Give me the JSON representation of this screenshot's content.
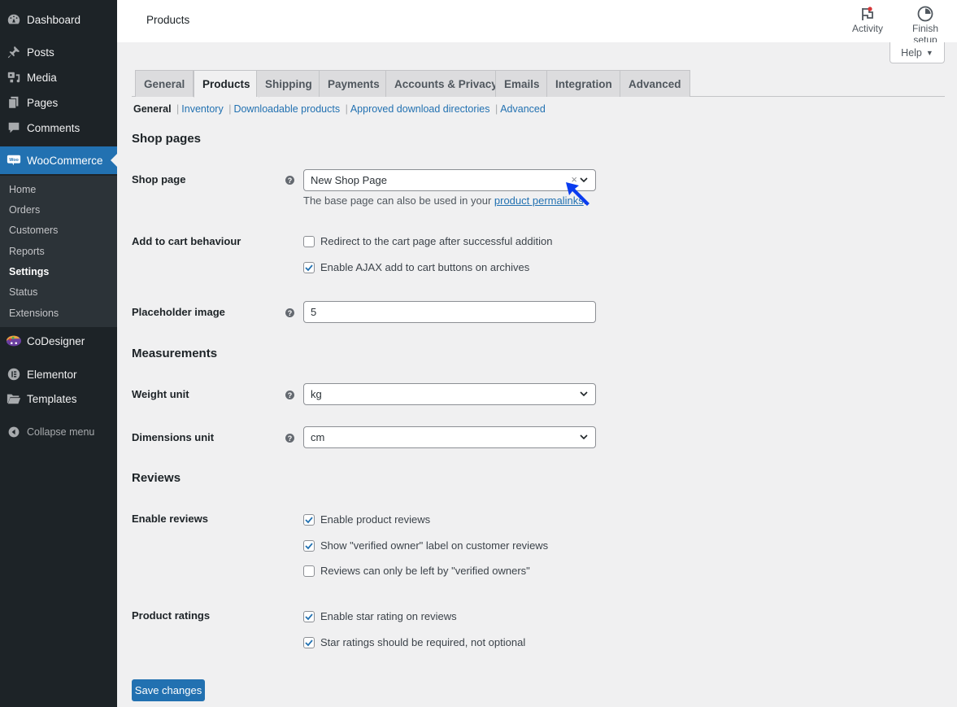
{
  "sidebar": {
    "items": [
      {
        "label": "Dashboard",
        "icon": "dashboard-icon"
      },
      {
        "label": "Posts",
        "icon": "pin-icon"
      },
      {
        "label": "Media",
        "icon": "media-icon"
      },
      {
        "label": "Pages",
        "icon": "pages-icon"
      },
      {
        "label": "Comments",
        "icon": "comment-icon"
      },
      {
        "label": "WooCommerce",
        "icon": "woo-icon"
      }
    ],
    "submenu": [
      "Home",
      "Orders",
      "Customers",
      "Reports",
      "Settings",
      "Status",
      "Extensions"
    ],
    "current_submenu": "Settings",
    "after_items": [
      {
        "label": "CoDesigner",
        "icon": "palette-icon"
      },
      {
        "label": "Elementor",
        "icon": "elementor-icon"
      },
      {
        "label": "Templates",
        "icon": "folder-icon"
      }
    ],
    "collapse_label": "Collapse menu"
  },
  "header": {
    "title": "Products",
    "activity_label": "Activity",
    "finish_setup_label": "Finish setup",
    "help_label": "Help"
  },
  "tabs": [
    {
      "label": "General"
    },
    {
      "label": "Products",
      "active": true
    },
    {
      "label": "Shipping"
    },
    {
      "label": "Payments"
    },
    {
      "label": "Accounts & Privacy"
    },
    {
      "label": "Emails"
    },
    {
      "label": "Integration"
    },
    {
      "label": "Advanced"
    }
  ],
  "subnav": {
    "current": "General",
    "links": [
      "Inventory",
      "Downloadable products",
      "Approved download directories",
      "Advanced"
    ]
  },
  "form": {
    "shop_pages_title": "Shop pages",
    "shop_page": {
      "label": "Shop page",
      "value": "New Shop Page",
      "clear_glyph": "×",
      "desc_prefix": "The base page can also be used in your ",
      "desc_link": "product permalinks",
      "desc_suffix": "."
    },
    "add_to_cart": {
      "label": "Add to cart behaviour",
      "options": [
        {
          "label": "Redirect to the cart page after successful addition",
          "checked": false
        },
        {
          "label": "Enable AJAX add to cart buttons on archives",
          "checked": true
        }
      ]
    },
    "placeholder_image": {
      "label": "Placeholder image",
      "value": "5"
    },
    "measurements_title": "Measurements",
    "weight_unit": {
      "label": "Weight unit",
      "value": "kg"
    },
    "dimensions_unit": {
      "label": "Dimensions unit",
      "value": "cm"
    },
    "reviews_title": "Reviews",
    "enable_reviews": {
      "label": "Enable reviews",
      "options": [
        {
          "label": "Enable product reviews",
          "checked": true
        },
        {
          "label": "Show \"verified owner\" label on customer reviews",
          "checked": true
        },
        {
          "label": "Reviews can only be left by \"verified owners\"",
          "checked": false
        }
      ]
    },
    "product_ratings": {
      "label": "Product ratings",
      "options": [
        {
          "label": "Enable star rating on reviews",
          "checked": true
        },
        {
          "label": "Star ratings should be required, not optional",
          "checked": true
        }
      ]
    },
    "save_label": "Save changes",
    "help_glyph": "?"
  },
  "colors": {
    "accent": "#2271b1",
    "sidebar_bg": "#1d2327",
    "submenu_bg": "#2c3338",
    "page_bg": "#f0f0f1",
    "cursor": "#0a3cf0",
    "notification_dot": "#d63638"
  }
}
